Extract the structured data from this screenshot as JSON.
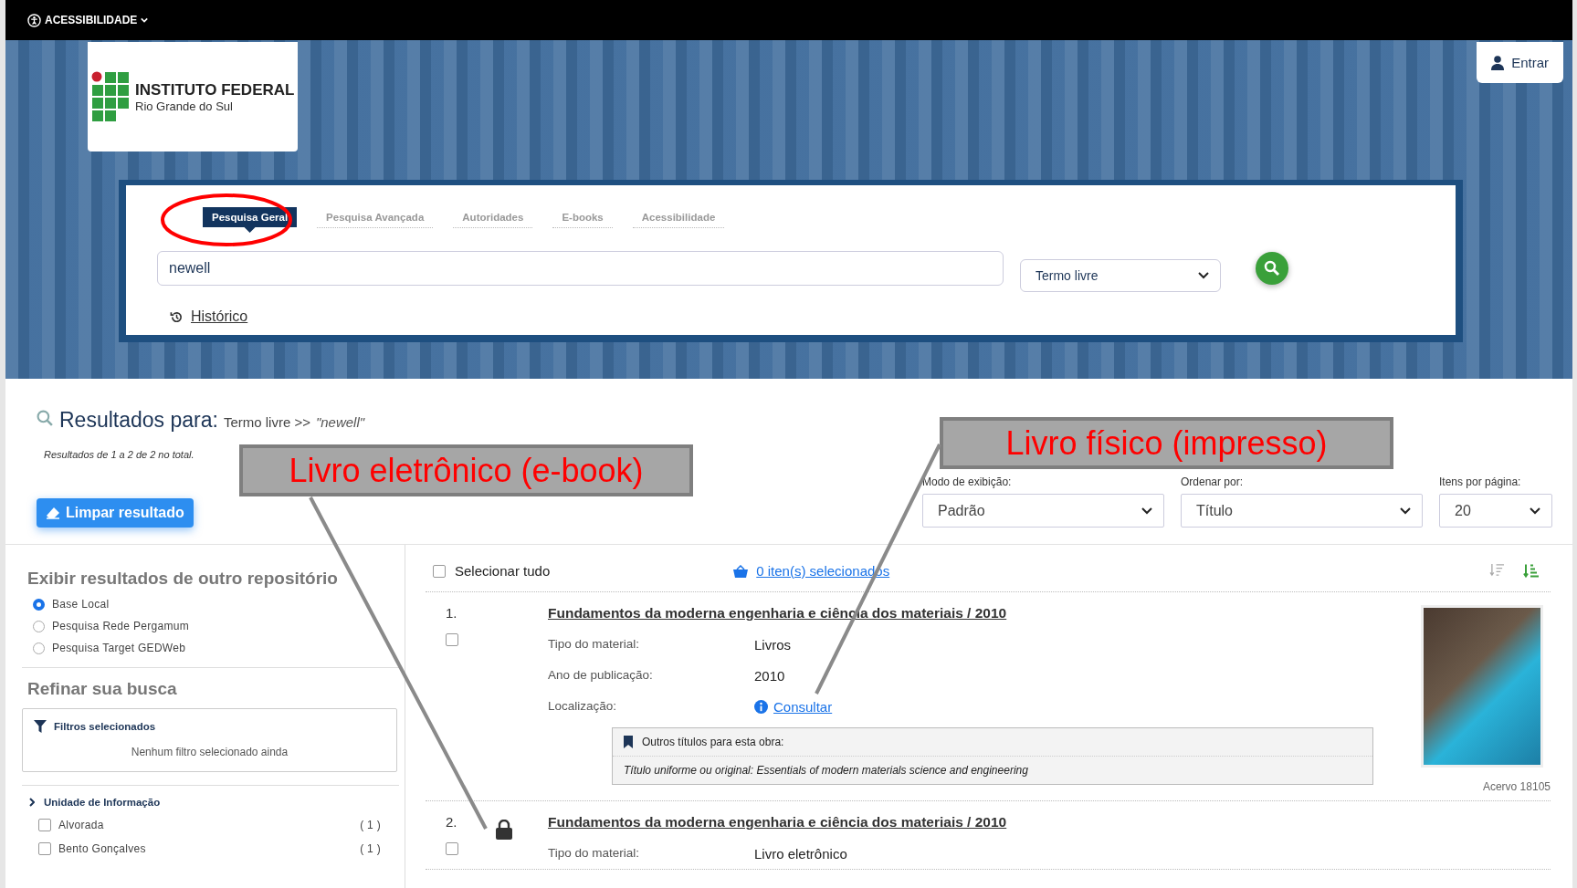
{
  "top_bar": {
    "accessibility_menu": "ACESSIBILIDADE"
  },
  "header": {
    "logo": {
      "title": "INSTITUTO FEDERAL",
      "subtitle": "Rio Grande do Sul"
    },
    "login_button": "Entrar"
  },
  "search": {
    "tabs": [
      {
        "label": "Pesquisa Geral",
        "selected": true
      },
      {
        "label": "Pesquisa Avançada",
        "selected": false
      },
      {
        "label": "Autoridades",
        "selected": false
      },
      {
        "label": "E-books",
        "selected": false
      },
      {
        "label": "Acessibilidade",
        "selected": false
      }
    ],
    "query": "newell",
    "field_select": "Termo livre",
    "history_link": "Histórico"
  },
  "results_header": {
    "title": "Resultados para:",
    "term": "Termo livre >>",
    "query": "\"newell\"",
    "summary": "Resultados de 1 a 2 de 2 no total.",
    "clear_button": "Limpar resultado"
  },
  "display_controls": [
    {
      "label": "Modo de exibição:",
      "value": "Padrão"
    },
    {
      "label": "Ordenar por:",
      "value": "Título"
    },
    {
      "label": "Itens por página:",
      "value": "20"
    }
  ],
  "sidebar": {
    "repository_title": "Exibir resultados de outro repositório",
    "repositories": [
      {
        "label": "Base Local",
        "selected": true
      },
      {
        "label": "Pesquisa Rede Pergamum",
        "selected": false
      },
      {
        "label": "Pesquisa Target GEDWeb",
        "selected": false
      }
    ],
    "refine_title": "Refinar sua busca",
    "filters_title": "Filtros selecionados",
    "filters_empty": "Nenhum filtro selecionado ainda",
    "facet": {
      "title": "Unidade de Informação",
      "items": [
        {
          "label": "Alvorada",
          "count": "( 1 )",
          "checked": false
        },
        {
          "label": "Bento Gonçalves",
          "count": "( 1 )",
          "checked": false
        }
      ]
    }
  },
  "results": {
    "select_all": {
      "label": "Selecionar tudo",
      "checked": false
    },
    "selected_link": "0 iten(s) selecionados",
    "items": [
      {
        "number": "1.",
        "kind": "physical",
        "checked": false,
        "title": "Fundamentos da moderna engenharia e ciência dos materiais / 2010",
        "fields": [
          {
            "label": "Tipo do material:",
            "value": "Livros",
            "kind": "text"
          },
          {
            "label": "Ano de publicação:",
            "value": "2010",
            "kind": "text"
          },
          {
            "label": "Localização:",
            "value": "Consultar",
            "kind": "link"
          }
        ],
        "other_titles": {
          "heading": "Outros títulos para esta obra:",
          "text": "Título uniforme ou original: Essentials of modern materials science and engineering"
        },
        "acervo": "Acervo 18105"
      },
      {
        "number": "2.",
        "kind": "ebook",
        "checked": false,
        "title": "Fundamentos da moderna engenharia e ciência dos materiais / 2010",
        "fields": [
          {
            "label": "Tipo do material:",
            "value": "Livro eletrônico",
            "kind": "text"
          }
        ]
      }
    ]
  },
  "annotations": [
    {
      "text": "Livro eletrônico (e-book)"
    },
    {
      "text": "Livro físico (impresso)"
    }
  ]
}
